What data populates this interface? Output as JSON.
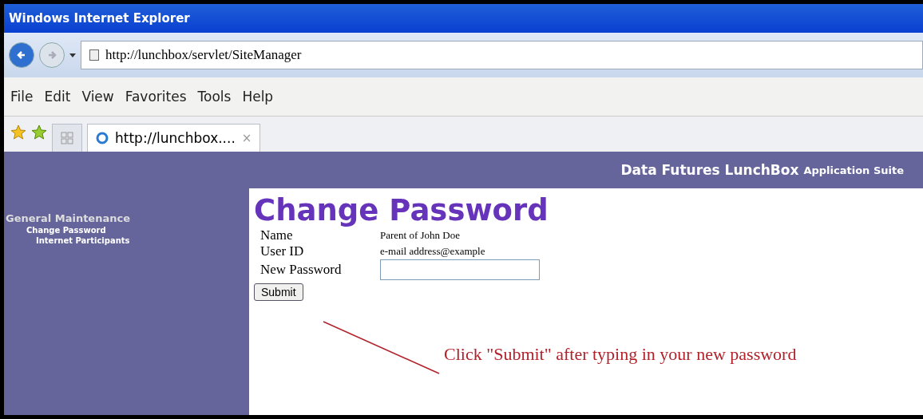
{
  "window": {
    "title": "Windows Internet Explorer"
  },
  "address_bar": {
    "value": "http://lunchbox/servlet/SiteManager"
  },
  "menu": [
    "File",
    "Edit",
    "View",
    "Favorites",
    "Tools",
    "Help"
  ],
  "tabs": [
    {
      "label": "http://lunchbox....",
      "close": "×",
      "selected": true
    }
  ],
  "page": {
    "brand": "Data Futures LunchBox",
    "brand_suffix": "Application Suite",
    "sidebar": {
      "heading": "General Maintenance",
      "items": [
        {
          "label": "Change Password",
          "children": [
            {
              "label": "Internet Participants"
            }
          ]
        }
      ]
    },
    "heading": "Change Password",
    "fields": [
      {
        "kind": "text",
        "label": "Name",
        "value": "Parent of John Doe"
      },
      {
        "kind": "text",
        "label": "User ID",
        "value": "e-mail address@example"
      },
      {
        "kind": "input",
        "label": "New Password"
      }
    ],
    "submit": "Submit",
    "annotation": "Click \"Submit\" after typing in your new password"
  }
}
